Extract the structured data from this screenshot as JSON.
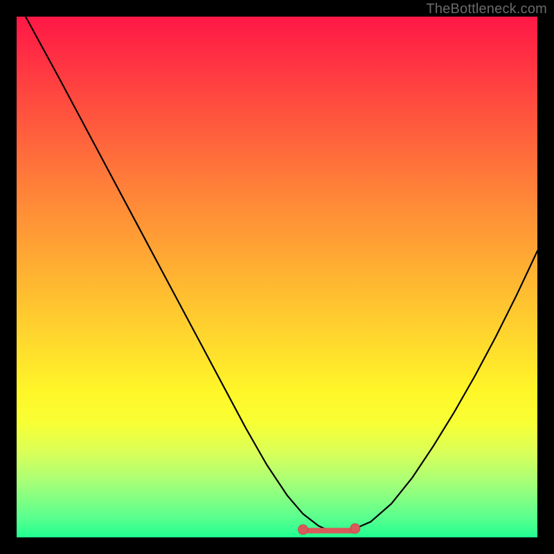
{
  "watermark": "TheBottleneck.com",
  "colors": {
    "frame": "#000000",
    "curve": "#000000",
    "marker_fill": "#d95a5a",
    "marker_stroke": "#c74848",
    "gradient_top": "#ff1846",
    "gradient_bottom": "#20ff90"
  },
  "chart_data": {
    "type": "line",
    "title": "",
    "xlabel": "",
    "ylabel": "",
    "x_range": [
      0,
      100
    ],
    "y_range": [
      0,
      100
    ],
    "grid": false,
    "legend": false,
    "series": [
      {
        "name": "curve",
        "x": [
          0,
          2,
          5,
          8,
          12,
          16,
          20,
          24,
          28,
          32,
          36,
          40,
          44,
          48,
          52,
          55,
          58,
          60,
          62,
          65,
          68,
          72,
          76,
          80,
          84,
          88,
          92,
          96,
          100
        ],
        "y": [
          103,
          99.5,
          94,
          88.5,
          81,
          73.5,
          66,
          58.5,
          51,
          43.5,
          36,
          28.5,
          21,
          14,
          8,
          4.5,
          2.2,
          1.3,
          1.2,
          1.7,
          3.0,
          6.5,
          11.5,
          17.5,
          24,
          31,
          38.5,
          46.5,
          55
        ]
      }
    ],
    "flat_region": {
      "x_start": 55,
      "x_end": 65,
      "y": 1.3
    },
    "markers": {
      "name": "end-points",
      "points": [
        {
          "x": 55,
          "y": 1.5
        },
        {
          "x": 65,
          "y": 1.7
        }
      ]
    }
  }
}
